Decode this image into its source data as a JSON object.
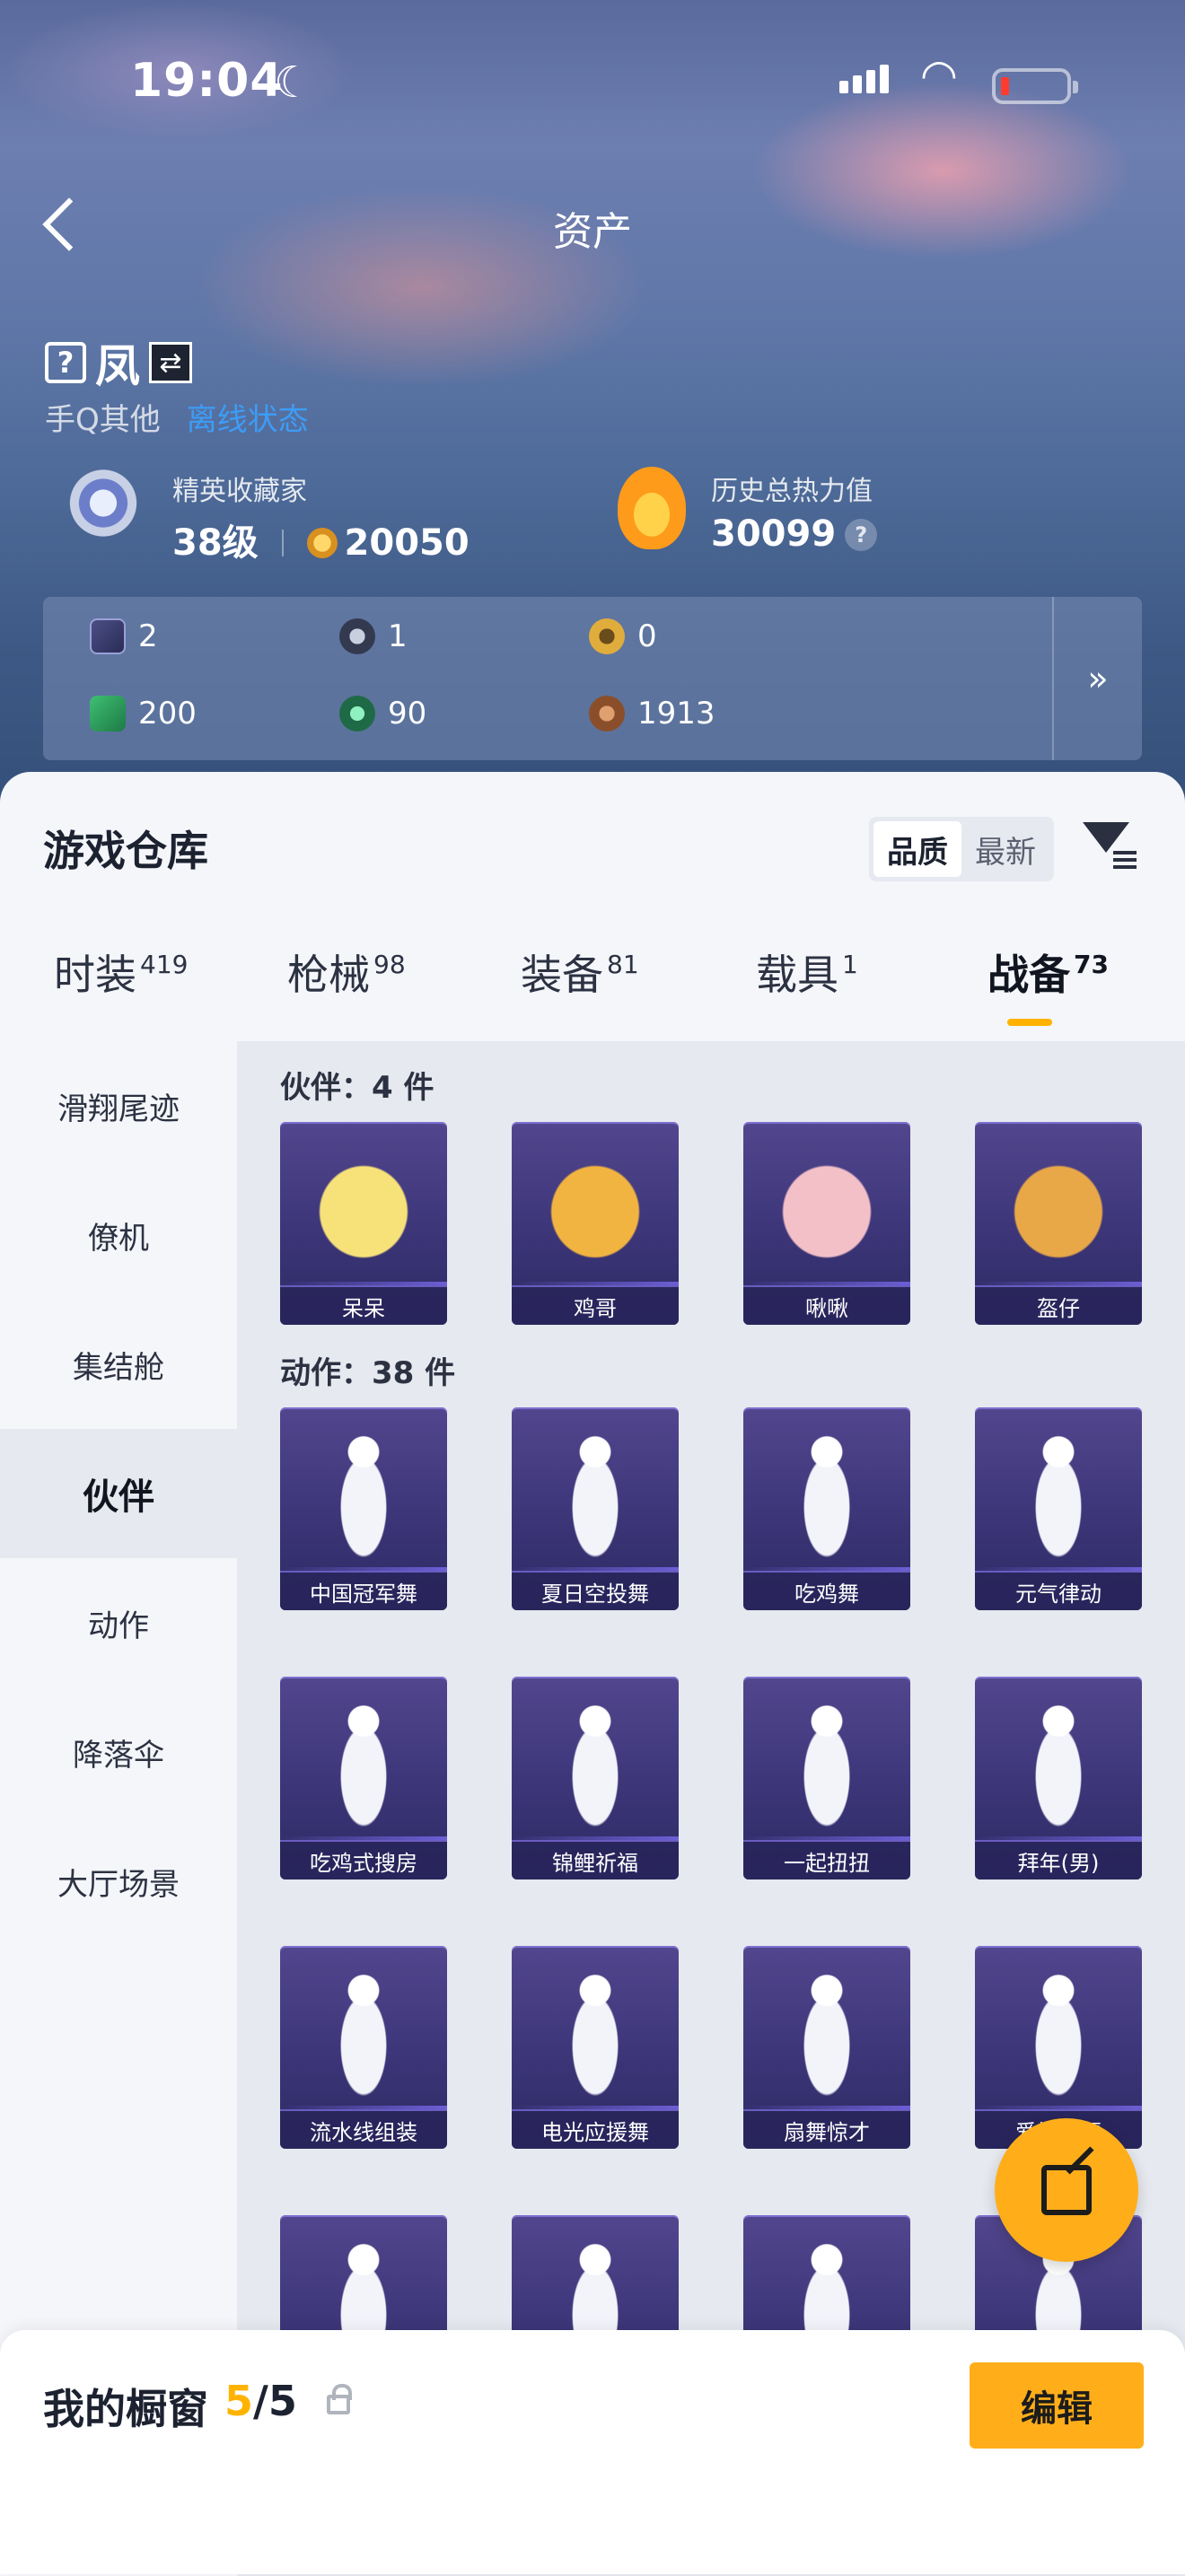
{
  "status_bar": {
    "time": "19:04"
  },
  "nav": {
    "title": "资产"
  },
  "player": {
    "name": "凤",
    "platform": "手Q其他",
    "presence": "离线状态"
  },
  "stats": {
    "collector_label": "精英收藏家",
    "level": "38级",
    "coins": "20050",
    "heat_label": "历史总热力值",
    "heat_value": "30099"
  },
  "currencies": [
    {
      "icon": "card-icon",
      "value": "2"
    },
    {
      "icon": "token-icon",
      "value": "1"
    },
    {
      "icon": "gold-token-icon",
      "value": "0"
    },
    {
      "icon": "green-card-icon",
      "value": "200"
    },
    {
      "icon": "green-orb-icon",
      "value": "90"
    },
    {
      "icon": "bronze-coin-icon",
      "value": "1913"
    }
  ],
  "warehouse": {
    "title": "游戏仓库",
    "sort_options": [
      "品质",
      "最新"
    ],
    "active_sort": "品质"
  },
  "tabs": [
    {
      "label": "时装",
      "count": "419"
    },
    {
      "label": "枪械",
      "count": "98"
    },
    {
      "label": "装备",
      "count": "81"
    },
    {
      "label": "载具",
      "count": "1"
    },
    {
      "label": "战备",
      "count": "73"
    }
  ],
  "active_tab": "战备",
  "sidebar": [
    "滑翔尾迹",
    "僚机",
    "集结舱",
    "伙伴",
    "动作",
    "降落伞",
    "大厅场景"
  ],
  "active_sidebar": "伙伴",
  "sections": {
    "partners_title": "伙伴：4 件",
    "partners": [
      "呆呆",
      "鸡哥",
      "啾啾",
      "盔仔"
    ],
    "actions_title": "动作：38 件",
    "actions": [
      "中国冠军舞",
      "夏日空投舞",
      "吃鸡舞",
      "元气律动",
      "吃鸡式搜房",
      "锦鲤祈福",
      "一起扭扭",
      "拜年(男)",
      "流水线组装",
      "电光应援舞",
      "扇舞惊才",
      "爱神祝福"
    ]
  },
  "showcase": {
    "label": "我的橱窗",
    "current": "5",
    "total": "/5",
    "edit_label": "编辑"
  },
  "colors": {
    "accent": "#ffae1a",
    "online": "#3d9cf5",
    "tile": "#3c3578"
  }
}
